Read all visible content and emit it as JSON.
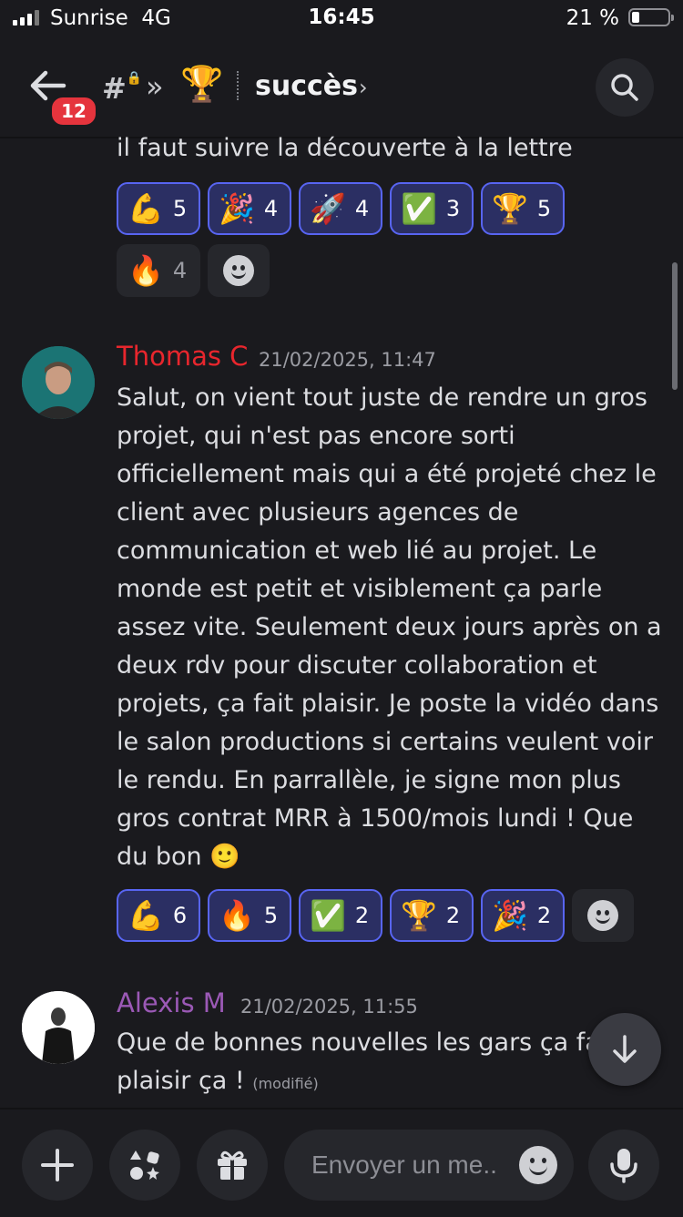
{
  "status_bar": {
    "carrier": "Sunrise",
    "network": "4G",
    "time": "16:45",
    "battery": "21 %",
    "battery_level": 0.21
  },
  "header": {
    "badge": "12",
    "channel_emoji": "🏆",
    "channel_name": "succès",
    "chevron": "›"
  },
  "prev_message": {
    "tail_text": "il faut suivre la découverte à la lettre",
    "reactions": [
      {
        "emoji": "💪",
        "count": "5",
        "active": true
      },
      {
        "emoji": "🎉",
        "count": "4",
        "active": true
      },
      {
        "emoji": "🚀",
        "count": "4",
        "active": true
      },
      {
        "emoji": "✅",
        "count": "3",
        "active": true
      },
      {
        "emoji": "🏆",
        "count": "5",
        "active": true
      },
      {
        "emoji": "🔥",
        "count": "4",
        "active": false
      }
    ]
  },
  "messages": [
    {
      "author": "Thomas C",
      "author_color": "#e8262d",
      "timestamp": "21/02/2025, 11:47",
      "text": "Salut, on vient tout juste de rendre un gros projet, qui n'est pas encore sorti officiellement mais qui a été projeté chez le client avec plusieurs agences de communication et web lié au projet. Le monde est petit et visiblement ça parle assez vite. Seulement deux jours après on a deux rdv pour discuter collaboration et projets, ça fait plaisir. Je poste la vidéo dans le salon productions si certains veulent voir le rendu. En parrallèle, je signe mon plus gros contrat MRR à 1500/mois lundi ! Que du bon 🙂",
      "reactions": [
        {
          "emoji": "💪",
          "count": "6",
          "active": true
        },
        {
          "emoji": "🔥",
          "count": "5",
          "active": true
        },
        {
          "emoji": "✅",
          "count": "2",
          "active": true
        },
        {
          "emoji": "🏆",
          "count": "2",
          "active": true
        },
        {
          "emoji": "🎉",
          "count": "2",
          "active": true
        }
      ]
    },
    {
      "author": "Alexis M",
      "author_color": "#9b59b6",
      "timestamp": "21/02/2025, 11:55",
      "text": "Que de bonnes nouvelles les gars ça fait plaisir ça !",
      "edited": "(modifié)"
    }
  ],
  "composer": {
    "placeholder": "Envoyer un me.."
  },
  "icons": {
    "back": "arrow-left-icon",
    "channel": "hash-lock-icon",
    "search": "search-icon",
    "add": "plus-icon",
    "apps": "apps-icon",
    "gift": "gift-icon",
    "emoji": "emoji-icon",
    "mic": "mic-icon",
    "jump": "arrow-down-icon"
  }
}
